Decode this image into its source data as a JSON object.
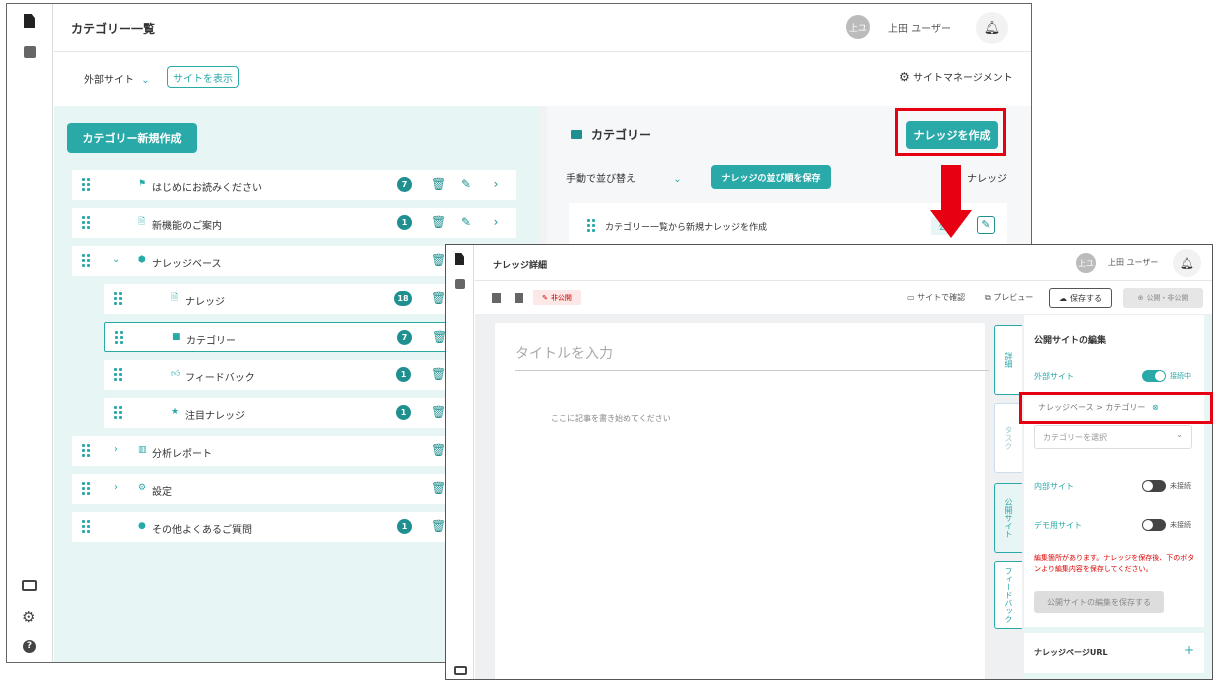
{
  "back": {
    "page_title": "カテゴリー一覧",
    "user": {
      "avatar_text": "上ユ",
      "name": "上田 ユーザー"
    },
    "site_select": "外部サイト",
    "view_site_label": "サイトを表示",
    "site_manage_label": "サイトマネージメント",
    "new_category_label": "カテゴリー新規作成",
    "tree": [
      {
        "label": "はじめにお読みください",
        "icon": "flag-icon",
        "badge": "7"
      },
      {
        "label": "新機能のご案内",
        "icon": "document-icon",
        "badge": "1"
      },
      {
        "label": "ナレッジベース",
        "icon": "cube-icon",
        "badge": ""
      },
      {
        "label": "ナレッジ",
        "icon": "document-icon",
        "badge": "18"
      },
      {
        "label": "カテゴリー",
        "icon": "folder-icon",
        "badge": "7"
      },
      {
        "label": "フィードバック",
        "icon": "thumb-icon",
        "badge": "1"
      },
      {
        "label": "注目ナレッジ",
        "icon": "star-icon",
        "badge": "1"
      },
      {
        "label": "分析レポート",
        "icon": "chart-icon",
        "badge": ""
      },
      {
        "label": "設定",
        "icon": "gear-icon",
        "badge": ""
      },
      {
        "label": "その他よくあるご質問",
        "icon": "help-icon",
        "badge": "1"
      }
    ],
    "right": {
      "header": "カテゴリー",
      "create_knowledge_label": "ナレッジを作成",
      "sort_label": "手動で並び替え",
      "save_order_label": "ナレッジの並び順を保存",
      "knowledge_tab": "ナレッジ",
      "item_label": "カテゴリー一覧から新規ナレッジを作成",
      "item_status": "公"
    }
  },
  "front": {
    "page_title": "ナレッジ詳細",
    "user": {
      "avatar_text": "上ユ",
      "name": "上田 ユーザー"
    },
    "status_label": "非公開",
    "check_site_label": "サイトで確認",
    "preview_label": "プレビュー",
    "save_label": "保存する",
    "publish_label": "公開・非公開",
    "title_placeholder": "タイトルを入力",
    "body_placeholder": "ここに記事を書き始めてください",
    "tabs": [
      "詳細",
      "タスク",
      "公開サイト",
      "フィードバック"
    ],
    "panel": {
      "header": "公開サイトの編集",
      "external_label": "外部サイト",
      "external_state": "接続中",
      "breadcrumb": "ナレッジベース > カテゴリー",
      "category_placeholder": "カテゴリーを選択",
      "internal_label": "内部サイト",
      "internal_state": "未接続",
      "demo_label": "デモ用サイト",
      "demo_state": "未接続",
      "warning": "編集箇所があります。ナレッジを保存後、下のボタンより編集内容を保存してください。",
      "save_edit_label": "公開サイトの編集を保存する",
      "url_label": "ナレッジページURL",
      "add_symbol": "+"
    }
  },
  "colors": {
    "accent": "#2aa9a9",
    "highlight": "#e60012",
    "pane_bg": "#e8f5f5"
  }
}
